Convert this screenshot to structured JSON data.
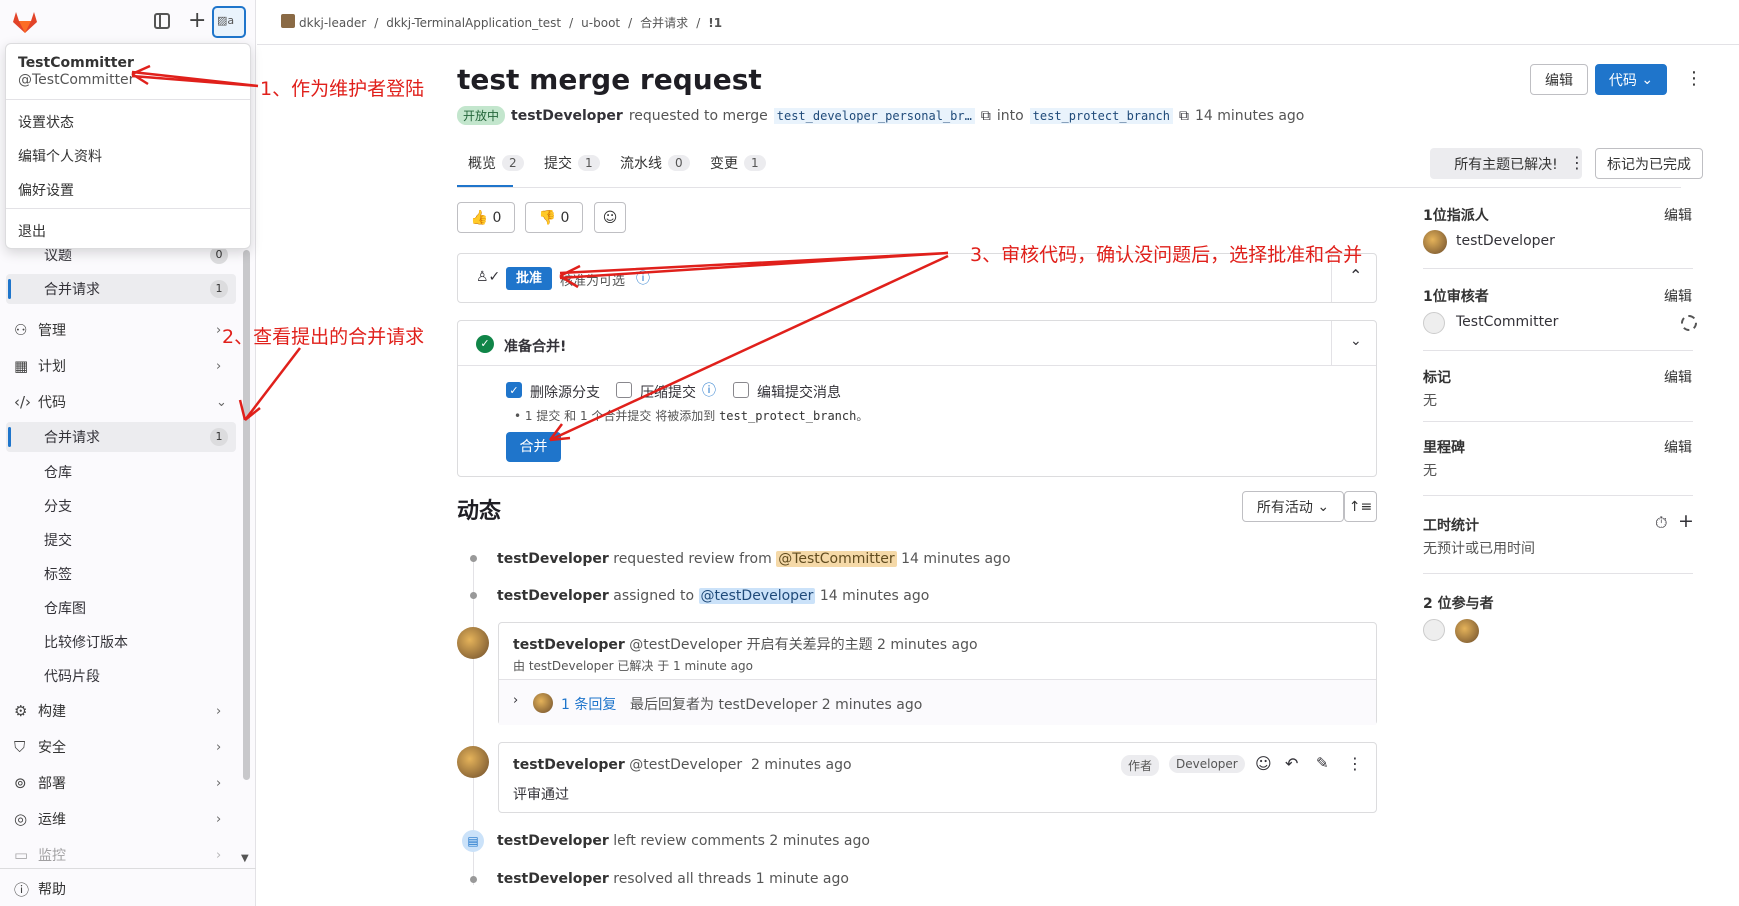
{
  "user_menu": {
    "name": "TestCommitter",
    "handle": "@TestCommitter",
    "items": [
      "设置状态",
      "编辑个人资料",
      "偏好设置"
    ],
    "logout": "退出"
  },
  "sidebar": {
    "issues": {
      "label": "议题",
      "count": "0"
    },
    "mr_top": {
      "label": "合并请求",
      "count": "1"
    },
    "manage": "管理",
    "plan": "计划",
    "code": "代码",
    "code_items": [
      {
        "label": "合并请求",
        "count": "1"
      },
      {
        "label": "仓库"
      },
      {
        "label": "分支"
      },
      {
        "label": "提交"
      },
      {
        "label": "标签"
      },
      {
        "label": "仓库图"
      },
      {
        "label": "比较修订版本"
      },
      {
        "label": "代码片段"
      }
    ],
    "build": "构建",
    "security": "安全",
    "deploy": "部署",
    "operate": "运维",
    "monitor": "监控",
    "help": "帮助"
  },
  "breadcrumb": [
    "dkkj-leader",
    "dkkj-TerminalApplication_test",
    "u-boot",
    "合并请求",
    "!1"
  ],
  "mr": {
    "title": "test merge request",
    "status": "开放中",
    "author": "testDeveloper",
    "requested": "requested to merge",
    "source": "test_developer_personal_br…",
    "into": "into",
    "target": "test_protect_branch",
    "time": "14 minutes ago"
  },
  "header_buttons": {
    "edit": "编辑",
    "code": "代码"
  },
  "tabs": [
    {
      "label": "概览",
      "count": "2"
    },
    {
      "label": "提交",
      "count": "1"
    },
    {
      "label": "流水线",
      "count": "0"
    },
    {
      "label": "变更",
      "count": "1"
    }
  ],
  "thread_buttons": {
    "resolved": "所有主题已解决!",
    "mark_done": "标记为已完成"
  },
  "reactions": {
    "up": "0",
    "down": "0"
  },
  "approval": {
    "button": "批准",
    "optional": "核准为可选"
  },
  "merge": {
    "ready": "准备合并!",
    "opt_delete": "删除源分支",
    "opt_squash": "压缩提交",
    "opt_edit": "编辑提交消息",
    "note_a": "1 提交 和 1 个合并提交 将被添加到",
    "note_branch": "test_protect_branch",
    "note_end": "。",
    "merge_button": "合并"
  },
  "activity": {
    "heading": "动态",
    "filter": "所有活动",
    "e1_user": "testDeveloper",
    "e1_text": "requested review from",
    "e1_mention": "@TestCommitter",
    "e1_time": "14 minutes ago",
    "e2_user": "testDeveloper",
    "e2_text": "assigned to",
    "e2_mention": "@testDeveloper",
    "e2_time": "14 minutes ago",
    "c1_user": "testDeveloper",
    "c1_handle": "@testDeveloper",
    "c1_text": "开启有关差异的主题",
    "c1_time": "2 minutes ago",
    "c1_resolved": "由 testDeveloper 已解决 于 1 minute ago",
    "c1_replies": "1 条回复",
    "c1_last": "最后回复者为 testDeveloper 2 minutes ago",
    "c2_user": "testDeveloper",
    "c2_handle": "@testDeveloper",
    "c2_time": "2 minutes ago",
    "c2_badge1": "作者",
    "c2_badge2": "Developer",
    "c2_body": "评审通过",
    "e3_user": "testDeveloper",
    "e3_text": "left review comments 2 minutes ago",
    "e4_user": "testDeveloper",
    "e4_text": "resolved all threads 1 minute ago"
  },
  "right": {
    "assignee_label": "1位指派人",
    "assignee": "testDeveloper",
    "reviewer_label": "1位审核者",
    "reviewer": "TestCommitter",
    "labels_label": "标记",
    "labels_val": "无",
    "milestone_label": "里程碑",
    "milestone_val": "无",
    "time_label": "工时统计",
    "time_val": "无预计或已用时间",
    "participants_label": "2 位参与者",
    "edit": "编辑"
  },
  "annotations": {
    "a1": "1、作为维护者登陆",
    "a2": "2、查看提出的合并请求",
    "a3": "3、审核代码，确认没问题后，选择批准和合并"
  }
}
